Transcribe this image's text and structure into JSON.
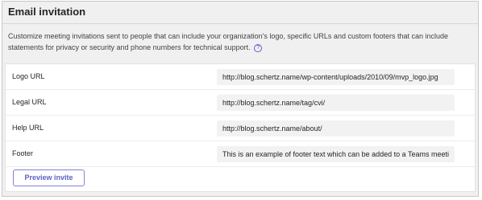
{
  "section": {
    "title": "Email invitation",
    "description": "Customize meeting invitations sent to people that can include your organization's logo, specific URLs and custom footers that can include statements for privacy or security and phone numbers for technical support.",
    "help_icon": "question-circle-icon"
  },
  "fields": [
    {
      "label": "Logo URL",
      "value": "http://blog.schertz.name/wp-content/uploads/2010/09/mvp_logo.jpg"
    },
    {
      "label": "Legal URL",
      "value": "http://blog.schertz.name/tag/cvi/"
    },
    {
      "label": "Help URL",
      "value": "http://blog.schertz.name/about/"
    },
    {
      "label": "Footer",
      "value": "This is an example of footer text which can be added to a Teams meeting invitation"
    }
  ],
  "preview_button": {
    "label": "Preview invite"
  },
  "colors": {
    "accent": "#5b5fc7",
    "panel_background": "#f0f0f0",
    "input_background": "#f2f2f2"
  }
}
